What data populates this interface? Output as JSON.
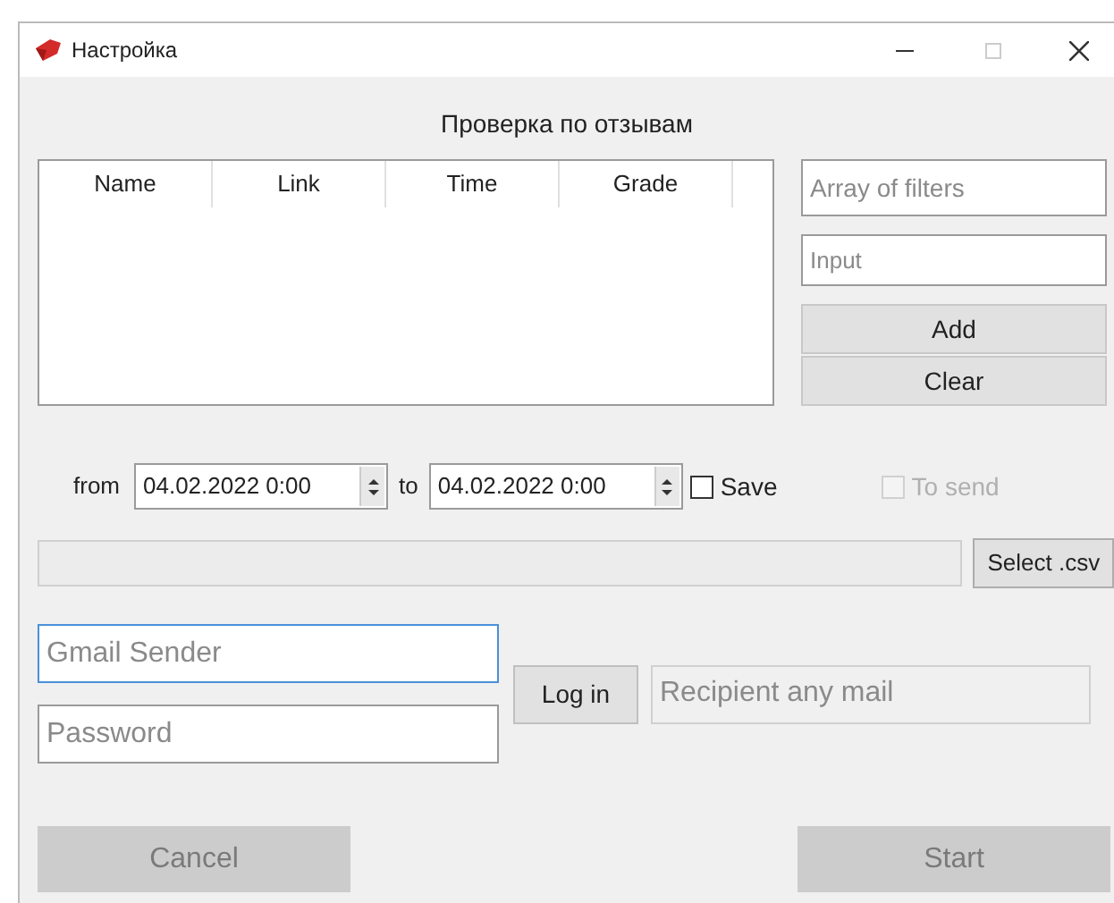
{
  "window": {
    "title": "Настройка"
  },
  "heading": "Проверка по отзывам",
  "table": {
    "columns": [
      "Name",
      "Link",
      "Time",
      "Grade"
    ]
  },
  "filters": {
    "list": {
      "placeholder": "Array of filters"
    },
    "input": {
      "placeholder": "Input"
    },
    "buttons": [
      {
        "label": "Add",
        "disabled": false
      },
      {
        "label": "Clear",
        "disabled": false
      }
    ]
  },
  "dates": {
    "from_label": "from",
    "from": "04.02.2022 0:00",
    "to_label": "to",
    "to": "04.02.2022 0:00",
    "save": {
      "label": "Save",
      "checked": false,
      "disabled": false
    },
    "to_send": {
      "label": "To send",
      "checked": false,
      "disabled": true
    }
  },
  "csv": {
    "button": "Select .csv"
  },
  "login": {
    "sender": {
      "placeholder": "Gmail Sender",
      "focused": true
    },
    "password": {
      "placeholder": "Password",
      "focused": false
    },
    "button": "Log in",
    "recipient": {
      "placeholder": "Recipient any mail",
      "disabled": true
    }
  },
  "footer": [
    {
      "label": "Cancel",
      "disabled": true
    },
    {
      "label": "Start",
      "disabled": true
    }
  ]
}
